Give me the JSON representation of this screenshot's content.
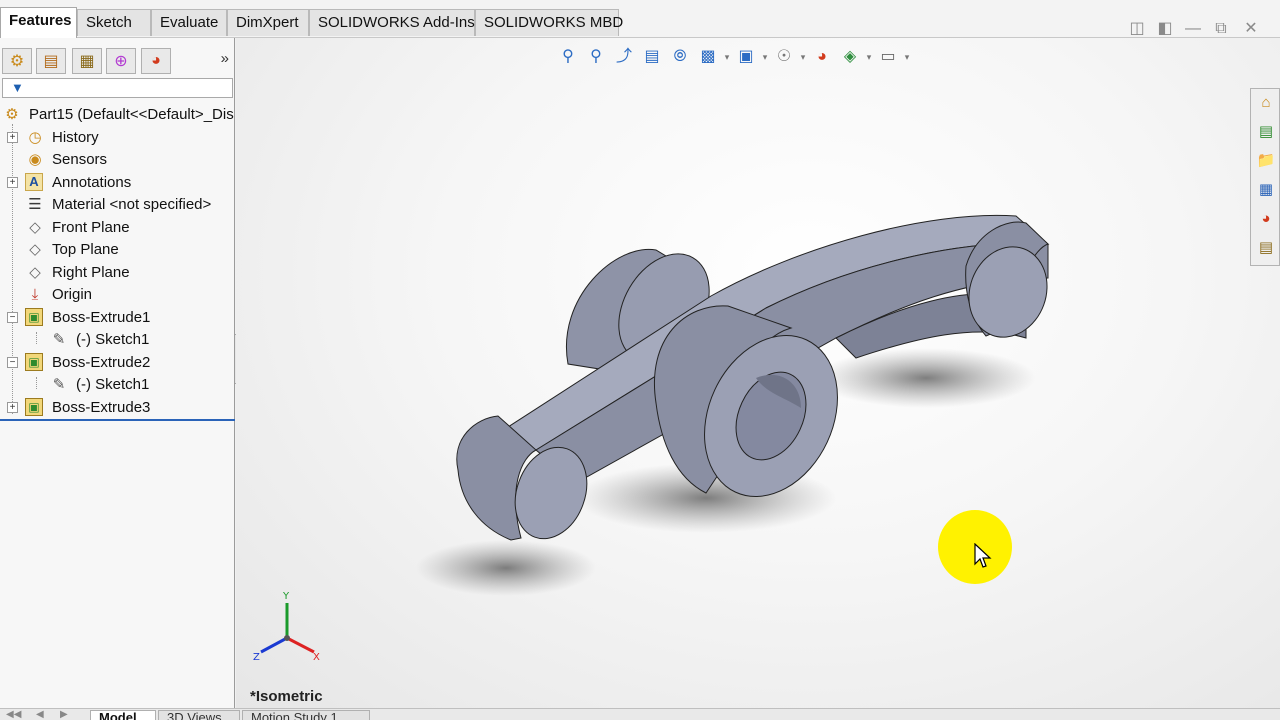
{
  "command_manager": {
    "tabs": [
      {
        "label": "Features",
        "active": true
      },
      {
        "label": "Sketch",
        "active": false
      },
      {
        "label": "Evaluate",
        "active": false
      },
      {
        "label": "DimXpert",
        "active": false
      },
      {
        "label": "SOLIDWORKS Add-Ins",
        "active": false
      },
      {
        "label": "SOLIDWORKS MBD",
        "active": false
      }
    ]
  },
  "window_controls": [
    "restore-tile-icon",
    "tile-icon",
    "minimize-icon",
    "restore-icon",
    "close-icon"
  ],
  "feature_manager": {
    "toolbar_icons": [
      "feature-manager-icon",
      "property-manager-icon",
      "configuration-manager-icon",
      "dimxpert-manager-icon",
      "display-manager-icon"
    ],
    "more_label": "»",
    "filter_icon": "filter-icon",
    "tree": {
      "root": "Part15  (Default<<Default>_Dis",
      "items": [
        {
          "label": "History",
          "icon": "history-icon"
        },
        {
          "label": "Sensors",
          "icon": "sensors-icon"
        },
        {
          "label": "Annotations",
          "icon": "annotations-icon"
        },
        {
          "label": "Material <not specified>",
          "icon": "material-icon"
        },
        {
          "label": "Front Plane",
          "icon": "plane-icon"
        },
        {
          "label": "Top Plane",
          "icon": "plane-icon"
        },
        {
          "label": "Right Plane",
          "icon": "plane-icon"
        },
        {
          "label": "Origin",
          "icon": "origin-icon"
        },
        {
          "label": "Boss-Extrude1",
          "icon": "boss-extrude-icon"
        },
        {
          "label": "(-) Sketch1",
          "icon": "sketch-icon"
        },
        {
          "label": "Boss-Extrude2",
          "icon": "boss-extrude-icon"
        },
        {
          "label": "(-) Sketch1",
          "icon": "sketch-icon"
        },
        {
          "label": "Boss-Extrude3",
          "icon": "boss-extrude-icon"
        }
      ]
    }
  },
  "heads_up_toolbar": [
    "zoom-to-fit-icon",
    "zoom-to-area-icon",
    "previous-view-icon",
    "section-view-icon",
    "dynamic-annotation-icon",
    "view-orientation-icon",
    "display-style-icon",
    "hide-show-items-icon",
    "edit-appearance-icon",
    "apply-scene-icon",
    "view-settings-icon"
  ],
  "task_pane": [
    "solidworks-resources-icon",
    "design-library-icon",
    "file-explorer-icon",
    "view-palette-icon",
    "appearances-scenes-icon",
    "custom-properties-icon"
  ],
  "triad": {
    "x": "X",
    "y": "Y",
    "z": "Z"
  },
  "view_label": "*Isometric",
  "bottom_tabs": [
    {
      "label": "Model",
      "active": true
    },
    {
      "label": "3D Views",
      "active": false
    },
    {
      "label": "Motion Study 1",
      "active": false
    }
  ],
  "colors": {
    "part_face": "#9aa0b5",
    "part_dark": "#7a7f93",
    "accent": "#2a63b8",
    "cursor_halo": "#fff200"
  }
}
